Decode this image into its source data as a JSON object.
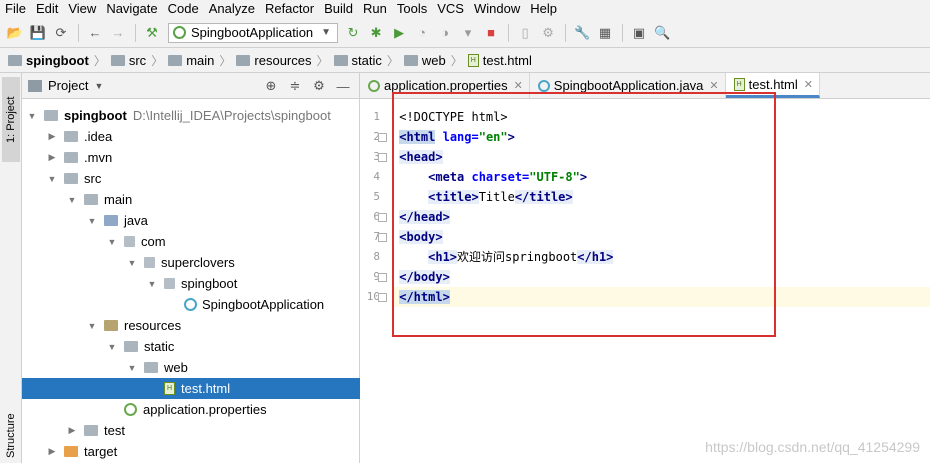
{
  "menu": [
    "File",
    "Edit",
    "View",
    "Navigate",
    "Code",
    "Analyze",
    "Refactor",
    "Build",
    "Run",
    "Tools",
    "VCS",
    "Window",
    "Help"
  ],
  "toolbar": {
    "run_config": "SpingbootApplication"
  },
  "breadcrumb": [
    "spingboot",
    "src",
    "main",
    "resources",
    "static",
    "web",
    "test.html"
  ],
  "sidebar_tabs": {
    "project": "1: Project",
    "structure": "Structure"
  },
  "project_panel": {
    "title": "Project",
    "tree": [
      {
        "label": "spingboot",
        "path": "D:\\Intellij_IDEA\\Projects\\spingboot"
      },
      {
        "label": ".idea"
      },
      {
        "label": ".mvn"
      },
      {
        "label": "src"
      },
      {
        "label": "main"
      },
      {
        "label": "java"
      },
      {
        "label": "com"
      },
      {
        "label": "superclovers"
      },
      {
        "label": "spingboot"
      },
      {
        "label": "SpingbootApplication"
      },
      {
        "label": "resources"
      },
      {
        "label": "static"
      },
      {
        "label": "web"
      },
      {
        "label": "test.html"
      },
      {
        "label": "application.properties"
      },
      {
        "label": "test"
      },
      {
        "label": "target"
      }
    ]
  },
  "editor": {
    "tabs": [
      "application.properties",
      "SpingbootApplication.java",
      "test.html"
    ],
    "active_tab": "test.html",
    "line_numbers": [
      "1",
      "2",
      "3",
      "4",
      "5",
      "6",
      "7",
      "8",
      "9",
      "10"
    ],
    "code": {
      "l1": "<!DOCTYPE html>",
      "l2_tag": "<html",
      "l2_attr": "lang=",
      "l2_val": "\"en\"",
      "l2_end": ">",
      "l3": "<head>",
      "l4_tag": "<meta",
      "l4_attr": "charset=",
      "l4_val": "\"UTF-8\"",
      "l4_end": ">",
      "l5_open": "<title>",
      "l5_text": "Title",
      "l5_close": "</title>",
      "l6": "</head>",
      "l7": "<body>",
      "l8_open": "<h1>",
      "l8_text": "欢迎访问springboot",
      "l8_close": "</h1>",
      "l9": "</body>",
      "l10": "</html>"
    }
  },
  "watermark": "https://blog.csdn.net/qq_41254299",
  "colors": {
    "selection": "#2675bf",
    "annotation_box": "#d93030",
    "tag": "#000080",
    "attr": "#0000ff",
    "string": "#008000"
  }
}
